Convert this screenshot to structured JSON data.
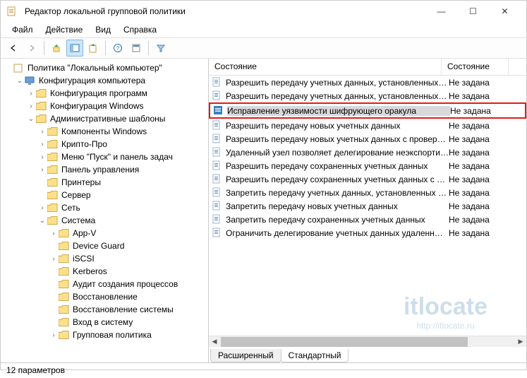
{
  "window": {
    "title": "Редактор локальной групповой политики",
    "min": "—",
    "max": "☐",
    "close": "✕"
  },
  "menu": {
    "file": "Файл",
    "action": "Действие",
    "view": "Вид",
    "help": "Справка"
  },
  "tree": {
    "root": "Политика \"Локальный компьютер\"",
    "comp_config": "Конфигурация компьютера",
    "prog_config": "Конфигурация программ",
    "win_config": "Конфигурация Windows",
    "admin_templates": "Административные шаблоны",
    "win_components": "Компоненты Windows",
    "crypto": "Крипто-Про",
    "start_menu": "Меню \"Пуск\" и панель задач",
    "control_panel": "Панель управления",
    "printers": "Принтеры",
    "server": "Сервер",
    "network": "Сеть",
    "system": "Система",
    "appv": "App-V",
    "device_guard": "Device Guard",
    "iscsi": "iSCSI",
    "kerberos": "Kerberos",
    "audit": "Аудит создания процессов",
    "restore": "Восстановление",
    "sysrestore": "Восстановление системы",
    "logon": "Вход в систему",
    "gp": "Групповая политика"
  },
  "list": {
    "header_state": "Состояние",
    "header_status": "Состояние",
    "status_unset": "Не задана",
    "rows": [
      "Разрешить передачу учетных данных, установленных по ...",
      "Разрешить передачу учетных данных, установленных по ...",
      "Исправление уязвимости шифрующего оракула",
      "Разрешить передачу новых учетных данных",
      "Разрешить передачу новых учетных данных с проверкой ...",
      "Удаленный узел позволяет делегирование неэкспортиру...",
      "Разрешить передачу сохраненных учетных данных",
      "Разрешить передачу сохраненных учетных данных с про...",
      "Запретить передачу учетных данных, установленных по у...",
      "Запретить передачу новых учетных данных",
      "Запретить передачу сохраненных учетных данных",
      "Ограничить делегирование учетных данных удаленным ..."
    ]
  },
  "tabs": {
    "extended": "Расширенный",
    "standard": "Стандартный"
  },
  "status": "12 параметров",
  "watermark": {
    "brand": "itlocate",
    "url": "http://itlocate.ru"
  }
}
